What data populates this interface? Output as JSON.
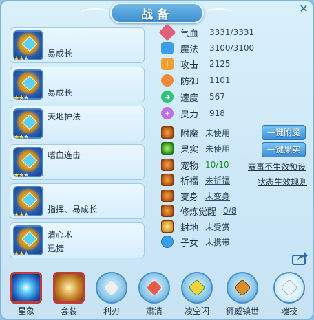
{
  "window": {
    "title": "战备"
  },
  "items": [
    {
      "line1": "",
      "line2": "易成长",
      "stars": 2
    },
    {
      "line1": "",
      "line2": "易成长",
      "stars": 2
    },
    {
      "line1": "天地护法",
      "line2": "",
      "stars": 2
    },
    {
      "line1": "嗜血连击",
      "line2": "",
      "stars": 2
    },
    {
      "line1": "",
      "line2": "指挥、易成长",
      "stars": 2
    },
    {
      "line1": "清心术",
      "line2": "迅捷",
      "stars": 2
    }
  ],
  "stats": [
    {
      "label": "气血",
      "value": "3331/3331",
      "icon": "heart-icon",
      "color": "#e0607a"
    },
    {
      "label": "魔法",
      "value": "3100/3100",
      "icon": "mana-icon",
      "color": "#3a9ee8"
    },
    {
      "label": "攻击",
      "value": "2125",
      "icon": "attack-icon",
      "color": "#f0a030"
    },
    {
      "label": "防御",
      "value": "1101",
      "icon": "defense-icon",
      "color": "#f08a3a"
    },
    {
      "label": "速度",
      "value": "567",
      "icon": "speed-icon",
      "color": "#2fc47a"
    },
    {
      "label": "灵力",
      "value": "918",
      "icon": "spirit-icon",
      "color": "#c070e0"
    }
  ],
  "rows": [
    {
      "label": "附魔",
      "value": "未使用"
    },
    {
      "label": "果实",
      "value": "未使用"
    },
    {
      "label": "宠物",
      "value": "10/10"
    },
    {
      "label": "祈福",
      "value": "未祈福"
    },
    {
      "label": "变身",
      "value": "未变身"
    },
    {
      "label": "修炼觉醒",
      "value": "0/8"
    },
    {
      "label": "封地",
      "value": "未受赏"
    },
    {
      "label": "子女",
      "value": "未携带"
    }
  ],
  "buttons": {
    "enchant": "一键附魔",
    "fruit": "一键果实"
  },
  "links": {
    "preset": "赛事不生效预设",
    "status_rules": "状态生效规则"
  },
  "tabs": [
    {
      "label": "星象"
    },
    {
      "label": "套装"
    },
    {
      "label": "利刃"
    },
    {
      "label": "肃清"
    },
    {
      "label": "凌空闪"
    },
    {
      "label": "狮威镇世"
    },
    {
      "label": "魂技"
    }
  ],
  "colors": {
    "panel_bg": "#cfe9f8",
    "title_bg": "#3f8fcf",
    "button_bg": "#3a8fd8",
    "pet_count": "#1e8f2a",
    "selected_tab_border": "#c23a3a"
  }
}
